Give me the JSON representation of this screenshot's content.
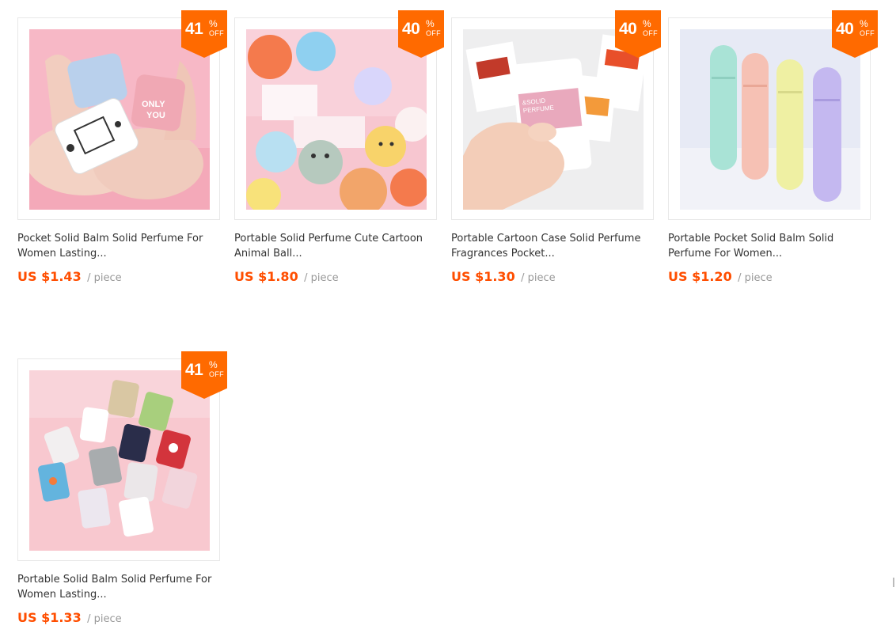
{
  "products": [
    {
      "discount": "41",
      "pct": "%",
      "off": "OFF",
      "title": "Pocket Solid Balm Solid Perfume For Women Lasting...",
      "price": "US $1.43",
      "unit": "/ piece",
      "image_icon": "pocket-tins-in-hands-image"
    },
    {
      "discount": "40",
      "pct": "%",
      "off": "OFF",
      "title": "Portable Solid Perfume Cute Cartoon Animal Ball...",
      "price": "US $1.80",
      "unit": "/ piece",
      "image_icon": "animal-balls-image"
    },
    {
      "discount": "40",
      "pct": "%",
      "off": "OFF",
      "title": "Portable Cartoon Case Solid Perfume Fragrances Pocket...",
      "price": "US $1.30",
      "unit": "/ piece",
      "image_icon": "perfume-card-hand-image"
    },
    {
      "discount": "40",
      "pct": "%",
      "off": "OFF",
      "title": "Portable Pocket Solid Balm Solid Perfume For Women...",
      "price": "US $1.20",
      "unit": "/ piece",
      "image_icon": "pastel-sticks-image"
    },
    {
      "discount": "41",
      "pct": "%",
      "off": "OFF",
      "title": "Portable Solid Balm Solid Perfume For Women Lasting...",
      "price": "US $1.33",
      "unit": "/ piece",
      "image_icon": "tin-collection-image"
    }
  ],
  "colors": {
    "accent": "#ff6a00",
    "price": "#ff4e00",
    "muted": "#999999",
    "border": "#e8e8e8"
  }
}
